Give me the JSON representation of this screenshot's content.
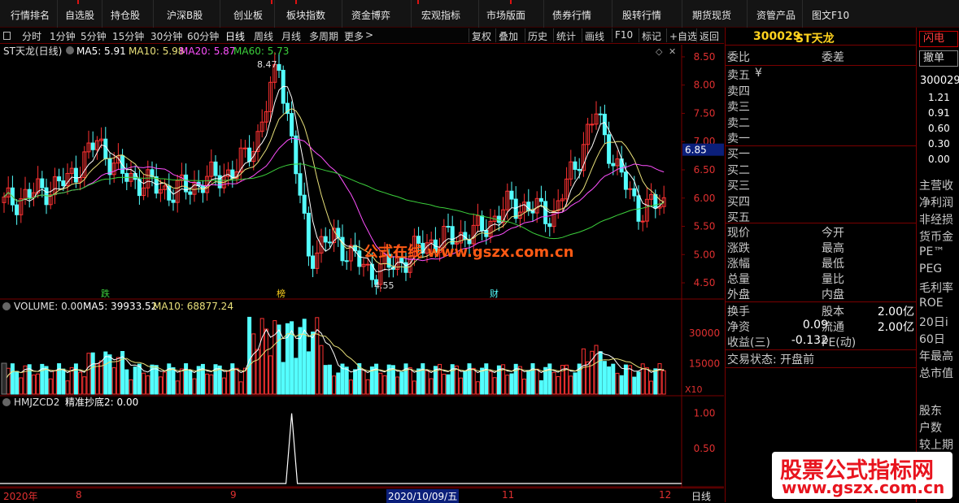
{
  "topnav": {
    "items": [
      "行情排名",
      "自选股",
      "持仓股",
      "沪深B股",
      "创业板",
      "板块指数",
      "资金博弈",
      "宏观指标",
      "市场版面",
      "债券行情",
      "股转行情",
      "期货现货",
      "资管产品",
      "图文F10"
    ]
  },
  "toolbar": {
    "periods": [
      "分时",
      "1分钟",
      "5分钟",
      "15分钟",
      "30分钟",
      "60分钟",
      "日线",
      "周线",
      "月线",
      "多周期",
      "更多"
    ],
    "active_period": "日线",
    "more_arrow": ">",
    "tools": [
      "复权",
      "叠加",
      "历史",
      "统计",
      "画线",
      "F10",
      "标记",
      "+自选",
      "返回"
    ]
  },
  "main_chart": {
    "legend_title": "ST天龙(日线)",
    "ma5": "MA5: 5.91",
    "ma10": "MA10: 5.98",
    "ma20": "MA20: 5.87",
    "ma60": "MA60: 5.73",
    "high_label": "8.47",
    "low_label": "4.55",
    "price_tag": "6.85",
    "y_ticks": [
      "8.50",
      "8.00",
      "7.50",
      "7.00",
      "6.50",
      "6.00",
      "5.50",
      "5.00",
      "4.50"
    ],
    "markers": [
      "跌",
      "榜",
      "财"
    ]
  },
  "volume_chart": {
    "legend": "VOLUME: 0.00",
    "ma5": "MA5: 39933.52",
    "ma10": "MA10: 68877.24",
    "y_ticks": [
      "30000",
      "15000"
    ],
    "unit": "X10"
  },
  "indicator_chart": {
    "legend_name": "HMJZCD2",
    "legend_value": "精准抄底2: 0.00",
    "y_ticks": [
      "1.00",
      "0.50"
    ]
  },
  "date_axis": {
    "labels": [
      "2020年",
      "8",
      "9",
      "2020/10/09/五",
      "11",
      "12"
    ],
    "period": "日线"
  },
  "colors": {
    "up": "#ff3232",
    "down": "#54ffff",
    "ma5": "#ffffff",
    "ma10": "#e8e07a",
    "ma20": "#ff50ff",
    "ma60": "#3cd03c",
    "border": "#7a0000"
  },
  "right_panel": {
    "code": "300029",
    "name": "ST天龙",
    "weibi": "委比",
    "weicha": "委差",
    "sell_levels": [
      "卖五",
      "卖四",
      "卖三",
      "卖二",
      "卖一"
    ],
    "yen_mark": "¥",
    "buy_levels": [
      "买一",
      "买二",
      "买三",
      "买四",
      "买五"
    ],
    "quote_left": [
      "现价",
      "涨跌",
      "涨幅",
      "总量",
      "外盘"
    ],
    "quote_right": [
      "今开",
      "最高",
      "最低",
      "量比",
      "内盘"
    ],
    "stats": [
      {
        "l": "换手",
        "m": "股本",
        "v": "2.00亿"
      },
      {
        "l": "净资",
        "v0": "0.09",
        "m": "流通",
        "v": "2.00亿"
      },
      {
        "l": "收益(三)",
        "v0": "-0.132",
        "m": "PE(动)",
        "v": ""
      }
    ],
    "trade_state": "交易状态: 开盘前"
  },
  "far_right": {
    "btn1": "闪电",
    "btn2": "撤单",
    "code": "300029",
    "values": [
      "1.21",
      "0.91",
      "0.60",
      "0.30",
      "0.00"
    ],
    "items": [
      "主营收",
      "净利润",
      "非经损",
      "货币金",
      "PE™",
      "PEG",
      "毛利率",
      "ROE",
      "20日i",
      "60日",
      "年最高",
      "总市值"
    ],
    "items2": [
      "股东",
      "户数",
      "较上期"
    ]
  },
  "watermarks": {
    "center": "公式在线 www.gszx.com.cn",
    "corner_title": "股票公式指标网",
    "corner_url": "www.gszx.com.cn"
  }
}
